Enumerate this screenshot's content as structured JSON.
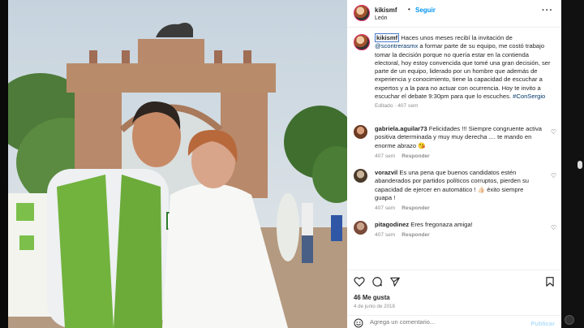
{
  "post": {
    "username": "kikismf",
    "follow_label": "Seguir",
    "location": "León",
    "more_label": "···"
  },
  "caption": {
    "username": "kikismf",
    "text_before_mention": " Haces unos meses recibí la invitación de ",
    "mention": "@scontrerasmx",
    "text_after_mention": " a formar parte de su equipo, me costó trabajo tomar la decisión porque no quería estar en la contienda electoral, hoy estoy convencida que tomé una gran decisión, ser parte de un equipo, liderado por un hombre que además de experiencia y conocimiento, tiene la capacidad de escuchar a expertos y a la para no actuar con ocurrencia. Hoy te invito a escuchar el debate 9:30pm para que lo escuches. ",
    "hashtag": "#ConSergio",
    "meta": "Editado · 407 sem"
  },
  "comments": [
    {
      "username": "gabriela.aguilar73",
      "text": " Felicidades !!! Siempre congruente activa positiva determinada y muy muy derecha .... te mando en enorme abrazo 😘",
      "time": "407 sem",
      "reply": "Responder"
    },
    {
      "username": "vorazvil",
      "text": " Es una pena que buenos candidatos estén abanderados por partidos políticos corruptos, pierden su capacidad de ejercer en automático ! 👍🏻 éxito siempre guapa !",
      "time": "407 sem",
      "reply": "Responder"
    },
    {
      "username": "pitagodinez",
      "text": " Eres fregonaza amiga!",
      "time": "407 sem",
      "reply": "Responder"
    }
  ],
  "likes": "46 Me gusta",
  "date": "4 de junio de 2018",
  "add_comment": {
    "placeholder": "Agrega un comentario...",
    "publish": "Publicar"
  },
  "icons": {
    "like": "heart-icon",
    "comment": "comment-icon",
    "share": "share-icon",
    "save": "bookmark-icon"
  },
  "colors": {
    "link": "#00376b",
    "follow": "#0095f6",
    "meta": "#8e8e8e"
  }
}
